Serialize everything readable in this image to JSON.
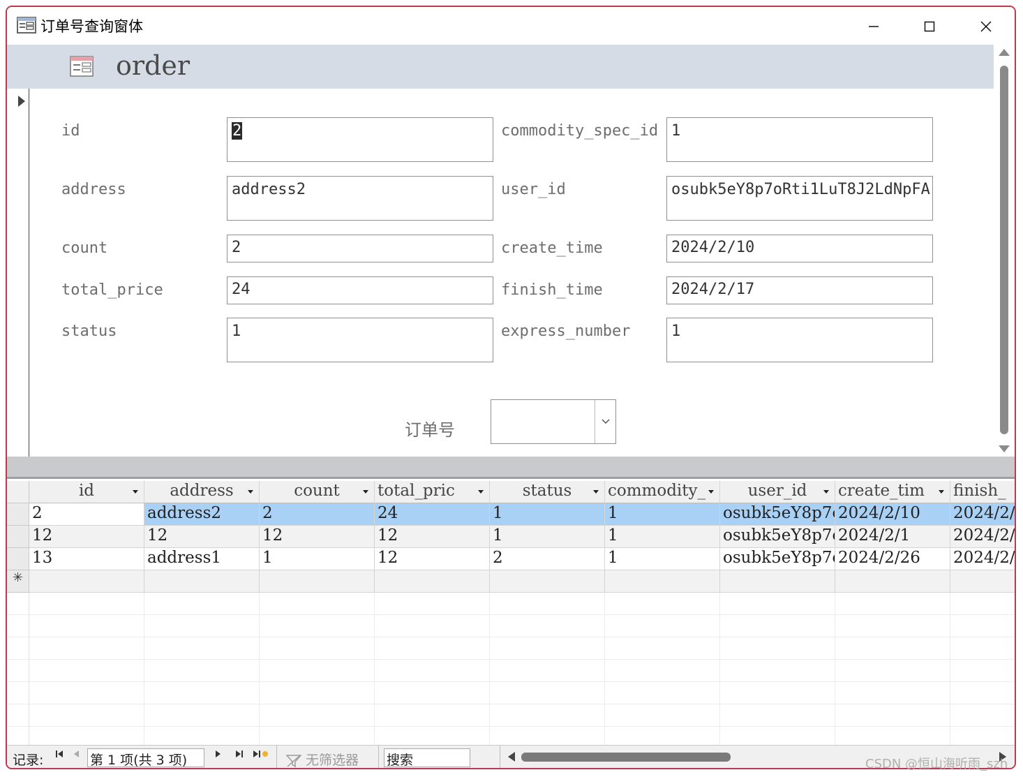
{
  "window": {
    "title": "订单号查询窗体",
    "minimize": "—",
    "maximize": "☐",
    "close": "✕"
  },
  "form": {
    "header_title": "order",
    "fields": [
      {
        "label": "id",
        "value": "2"
      },
      {
        "label": "commodity_spec_id",
        "value": "1"
      },
      {
        "label": "address",
        "value": "address2"
      },
      {
        "label": "user_id",
        "value": "osubk5eY8p7oRti1LuT8J2LdNpFA"
      },
      {
        "label": "count",
        "value": "2"
      },
      {
        "label": "create_time",
        "value": "2024/2/10"
      },
      {
        "label": "total_price",
        "value": "24"
      },
      {
        "label": "finish_time",
        "value": "2024/2/17"
      },
      {
        "label": "status",
        "value": "1"
      },
      {
        "label": "express_number",
        "value": "1"
      }
    ],
    "combo_label": "订单号",
    "combo_value": ""
  },
  "datasheet": {
    "columns": [
      "id",
      "address",
      "count",
      "total_pric",
      "status",
      "commodity_",
      "user_id",
      "create_tim",
      "finish_"
    ],
    "rows": [
      [
        "2",
        "address2",
        "2",
        "24",
        "1",
        "1",
        "osubk5eY8p7ol",
        "2024/2/10",
        "2024/2/"
      ],
      [
        "12",
        "12",
        "12",
        "12",
        "1",
        "1",
        "osubk5eY8p7ol",
        "2024/2/1",
        "2024/2/"
      ],
      [
        "13",
        "address1",
        "1",
        "12",
        "2",
        "1",
        "osubk5eY8p7ol",
        "2024/2/26",
        "2024/2/"
      ]
    ],
    "new_row_symbol": "✳"
  },
  "navigation": {
    "label": "记录:",
    "position": "第 1 项(共 3 项)",
    "filter": "无筛选器",
    "search": "搜索"
  },
  "watermark": "CSDN @恒山海听雨_szh",
  "colors": {
    "border": "#c0384b",
    "header_bg": "#d6dce5",
    "selected_row": "#a9d1f5"
  }
}
